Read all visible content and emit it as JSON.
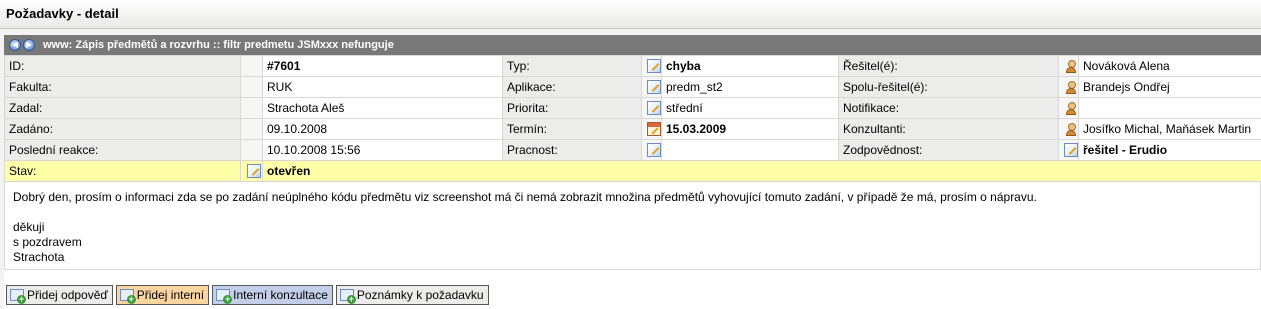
{
  "page": {
    "title": "Požadavky - detail"
  },
  "request": {
    "subject": "www: Zápis předmětů a rozvrhu :: filtr predmetu JSMxxx nefunguje",
    "fields": {
      "id": {
        "label": "ID:",
        "value": "#7601"
      },
      "faculty": {
        "label": "Fakulta:",
        "value": "RUK"
      },
      "submitter": {
        "label": "Zadal:",
        "value": "Strachota Aleš"
      },
      "submitted": {
        "label": "Zadáno:",
        "value": "09.10.2008"
      },
      "last_reaction": {
        "label": "Poslední reakce:",
        "value": "10.10.2008 15:56"
      },
      "type": {
        "label": "Typ:",
        "value": "chyba"
      },
      "application": {
        "label": "Aplikace:",
        "value": "predm_st2"
      },
      "priority": {
        "label": "Priorita:",
        "value": "střední"
      },
      "deadline": {
        "label": "Termín:",
        "value": "15.03.2009"
      },
      "effort": {
        "label": "Pracnost:",
        "value": ""
      },
      "solver": {
        "label": "Řešitel(é):",
        "value": "Nováková Alena"
      },
      "co_solver": {
        "label": "Spolu-řešitel(é):",
        "value": "Brandejs Ondřej"
      },
      "notification": {
        "label": "Notifikace:",
        "value": ""
      },
      "consultants": {
        "label": "Konzultanti:",
        "value": "Josífko Michal, Maňásek Martin"
      },
      "responsibility": {
        "label": "Zodpovědnost:",
        "value": "řešitel - Erudio"
      },
      "state": {
        "label": "Stav:",
        "value": "otevřen"
      }
    },
    "description": {
      "line1": "Dobrý den, prosím o informaci zda se po zadání neúplného kódu předmětu viz screenshot má či nemá zobrazit množina předmětů vyhovující tomuto zadání, v případě že má, prosím o nápravu.",
      "line2": "děkuji",
      "line3": "s pozdravem",
      "line4": "Strachota"
    }
  },
  "buttons": {
    "add_answer": "Přidej odpověď",
    "add_internal": "Přidej interní",
    "internal_consultation": "Interní konzultace",
    "request_notes": "Poznámky k požadavku"
  },
  "colors": {
    "header_bar": "#787878",
    "state_row": "#ffffa8",
    "internal_button": "#fbd5a0",
    "consultation_button": "#c3cfe8"
  }
}
